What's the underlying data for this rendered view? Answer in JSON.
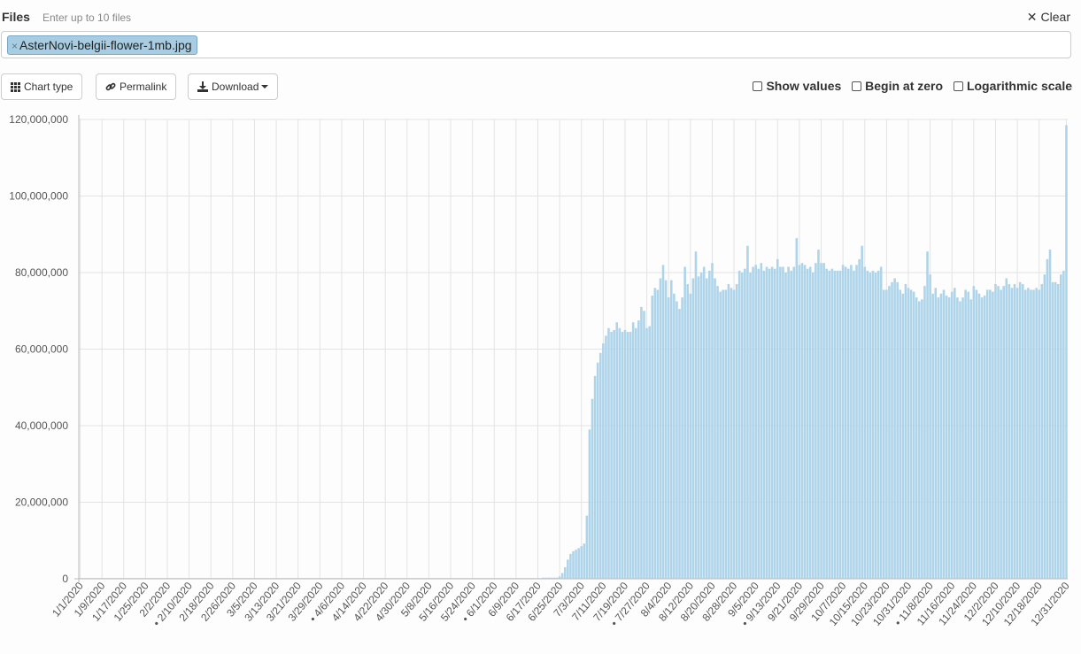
{
  "header": {
    "files_label": "Files",
    "files_hint": "Enter up to 10 files",
    "clear_label": "Clear"
  },
  "file_input": {
    "chips": [
      "AsterNovi-belgii-flower-1mb.jpg"
    ],
    "remove_glyph": "×"
  },
  "toolbar": {
    "chart_type_label": "Chart type",
    "permalink_label": "Permalink",
    "download_label": "Download",
    "show_values_label": "Show values",
    "begin_at_zero_label": "Begin at zero",
    "log_scale_label": "Logarithmic scale"
  },
  "colors": {
    "bar": "#aed4ea",
    "grid": "#e3e3e3",
    "axis": "#bbbbbb"
  },
  "chart_data": {
    "type": "bar",
    "title": "",
    "xlabel": "",
    "ylabel": "",
    "ylim": [
      0,
      120000000
    ],
    "yticks": [
      0,
      20000000,
      40000000,
      60000000,
      80000000,
      100000000,
      120000000
    ],
    "ytick_labels": [
      "0",
      "20,000,000",
      "40,000,000",
      "60,000,000",
      "80,000,000",
      "100,000,000",
      "120,000,000"
    ],
    "grid": true,
    "show_values": false,
    "begin_at_zero": false,
    "log_scale": false,
    "tick_labels": [
      "1/1/2020",
      "1/9/2020",
      "1/17/2020",
      "1/25/2020",
      "2/2/2020",
      "• 2/10/2020",
      "2/18/2020",
      "2/26/2020",
      "3/5/2020",
      "3/13/2020",
      "3/21/2020",
      "3/29/2020",
      "• 4/6/2020",
      "4/14/2020",
      "4/22/2020",
      "4/30/2020",
      "5/8/2020",
      "5/16/2020",
      "5/24/2020",
      "• 6/1/2020",
      "6/9/2020",
      "6/17/2020",
      "6/25/2020",
      "7/3/2020",
      "7/11/2020",
      "7/19/2020",
      "• 7/27/2020",
      "8/4/2020",
      "8/12/2020",
      "8/20/2020",
      "8/28/2020",
      "9/5/2020",
      "• 9/13/2020",
      "9/21/2020",
      "9/29/2020",
      "10/7/2020",
      "10/15/2020",
      "10/23/2020",
      "10/31/2020",
      "• 11/8/2020",
      "11/16/2020",
      "11/24/2020",
      "12/2/2020",
      "12/10/2020",
      "12/18/2020",
      "12/31/2020"
    ],
    "start_date": "2020-01-01",
    "values": [
      0,
      0,
      0,
      0,
      0,
      0,
      0,
      0,
      0,
      0,
      0,
      0,
      0,
      0,
      0,
      0,
      0,
      0,
      0,
      0,
      0,
      0,
      0,
      0,
      0,
      0,
      0,
      0,
      0,
      0,
      0,
      0,
      0,
      0,
      0,
      0,
      0,
      0,
      0,
      0,
      0,
      0,
      0,
      0,
      0,
      0,
      0,
      0,
      0,
      0,
      0,
      0,
      0,
      0,
      0,
      0,
      0,
      0,
      0,
      0,
      0,
      0,
      0,
      0,
      0,
      0,
      0,
      0,
      0,
      0,
      0,
      0,
      0,
      0,
      0,
      0,
      0,
      0,
      0,
      0,
      0,
      0,
      0,
      0,
      0,
      0,
      0,
      0,
      0,
      0,
      0,
      0,
      0,
      0,
      0,
      0,
      0,
      0,
      0,
      0,
      0,
      0,
      0,
      0,
      0,
      0,
      0,
      0,
      0,
      0,
      0,
      0,
      0,
      0,
      0,
      0,
      0,
      0,
      0,
      0,
      0,
      0,
      0,
      0,
      0,
      0,
      0,
      0,
      0,
      0,
      0,
      0,
      0,
      0,
      0,
      0,
      0,
      0,
      0,
      0,
      0,
      0,
      0,
      0,
      0,
      0,
      0,
      0,
      0,
      0,
      0,
      0,
      0,
      0,
      0,
      0,
      0,
      0,
      0,
      0,
      0,
      0,
      0,
      0,
      0,
      0,
      0,
      0,
      0,
      0,
      300000,
      300000,
      300000,
      300000,
      300000,
      300000,
      600000,
      1500000,
      3000000,
      5000000,
      6500000,
      7200000,
      7600000,
      8000000,
      8500000,
      9200000,
      16500000,
      39000000,
      47000000,
      53000000,
      56500000,
      59000000,
      61500000,
      63500000,
      65500000,
      64500000,
      65000000,
      67000000,
      65500000,
      64500000,
      65000000,
      64500000,
      64500000,
      67000000,
      65500000,
      67500000,
      71000000,
      70000000,
      65500000,
      66000000,
      74000000,
      76000000,
      75500000,
      78500000,
      82000000,
      78000000,
      73500000,
      78000000,
      74500000,
      72500000,
      70500000,
      73500000,
      81500000,
      77000000,
      74500000,
      78500000,
      85500000,
      79000000,
      80000000,
      81500000,
      78500000,
      80500000,
      82500000,
      78500000,
      76500000,
      75000000,
      75500000,
      75500000,
      77000000,
      76000000,
      75500000,
      77000000,
      80500000,
      80000000,
      81000000,
      87000000,
      80000000,
      81500000,
      82000000,
      81000000,
      82500000,
      80500000,
      81500000,
      81000000,
      81500000,
      81000000,
      83500000,
      81500000,
      81500000,
      80000000,
      81500000,
      80500000,
      81500000,
      89000000,
      82000000,
      82500000,
      82000000,
      81000000,
      81500000,
      80000000,
      82500000,
      86000000,
      82500000,
      82500000,
      81000000,
      80500000,
      81000000,
      80500000,
      80500000,
      80500000,
      82000000,
      81500000,
      81000000,
      82000000,
      80500000,
      82000000,
      83500000,
      87000000,
      81500000,
      80500000,
      80000000,
      80500000,
      80000000,
      80500000,
      81500000,
      75500000,
      75500000,
      76500000,
      77500000,
      78500000,
      77500000,
      75500000,
      74500000,
      77000000,
      76000000,
      75500000,
      75000000,
      73500000,
      72500000,
      73000000,
      76500000,
      85500000,
      79500000,
      74500000,
      76000000,
      73500000,
      74500000,
      75500000,
      74000000,
      73500000,
      75000000,
      76000000,
      73500000,
      72500000,
      73500000,
      75500000,
      75000000,
      73000000,
      76500000,
      75500000,
      74500000,
      73500000,
      74000000,
      75500000,
      75500000,
      75000000,
      77000000,
      76500000,
      75500000,
      76500000,
      78500000,
      77000000,
      76000000,
      77000000,
      76000000,
      77500000,
      77000000,
      75500000,
      76000000,
      75500000,
      75500000,
      76000000,
      75500000,
      77000000,
      79500000,
      83500000,
      86000000,
      77500000,
      77500000,
      77000000,
      79500000,
      80500000,
      118500000
    ]
  }
}
